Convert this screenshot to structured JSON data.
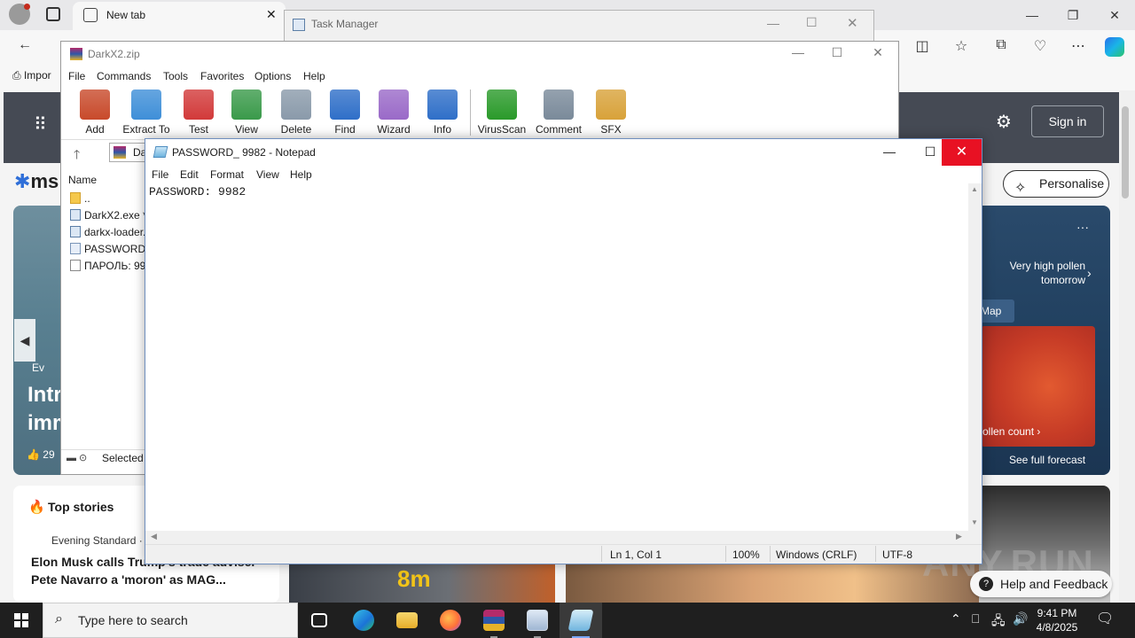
{
  "edge": {
    "tab_title": "New tab",
    "tab_close": "✕",
    "window_controls": [
      "—",
      "❐",
      "✕"
    ],
    "toolbar_icons": [
      "back-arrow-icon",
      "search-icon",
      "split-screen-icon",
      "favorites-star-icon",
      "collections-icon",
      "browser-essentials-icon",
      "more-menu-icon",
      "copilot-icon"
    ],
    "favorites_import": "Impor",
    "msn": {
      "logo": "ms",
      "sign_in": "Sign in",
      "personalise": "Personalise",
      "hero_source": "Ev",
      "hero_title_lines": [
        "Intr",
        "imm"
      ],
      "hero_likes": "29",
      "weather_alert": "Very high pollen tomorrow",
      "weather_map": "Map",
      "pollen_count": "ollen count ›",
      "see_full_forecast": "See full forecast",
      "top_stories": "Top stories",
      "story_source": "Evening Standard · 1",
      "story_headline": "Elon Musk calls Trump's trade adviser Pete Navarro a 'moron' as MAG...",
      "image_tag": "8m",
      "help_feedback": "Help and Feedback"
    },
    "watermark": "ANY.RUN"
  },
  "taskmanager": {
    "title": "Task Manager"
  },
  "winrar": {
    "title": "DarkX2.zip",
    "menu": [
      "File",
      "Commands",
      "Tools",
      "Favorites",
      "Options",
      "Help"
    ],
    "tools": [
      {
        "label": "Add",
        "color": "#c84a2b"
      },
      {
        "label": "Extract To",
        "color": "#3f8fd8"
      },
      {
        "label": "Test",
        "color": "#d23a3a"
      },
      {
        "label": "View",
        "color": "#3a9a4a"
      },
      {
        "label": "Delete",
        "color": "#8a9aaa"
      },
      {
        "label": "Find",
        "color": "#2f6fc8"
      },
      {
        "label": "Wizard",
        "color": "#9a6ac8"
      },
      {
        "label": "Info",
        "color": "#2f6fc8"
      },
      {
        "label": "VirusScan",
        "color": "#2a9a2a"
      },
      {
        "label": "Comment",
        "color": "#7a8a9a"
      },
      {
        "label": "SFX",
        "color": "#d8a23a"
      }
    ],
    "address": "Da",
    "column_name": "Name",
    "files": [
      "..",
      "DarkX2.exe *",
      "darkx-loader.",
      "PASSWORD: 9",
      "ПАРОЛЬ: 998"
    ],
    "status": "Selected"
  },
  "notepad": {
    "title": "PASSWORD_ 9982 - Notepad",
    "menu": [
      "File",
      "Edit",
      "Format",
      "View",
      "Help"
    ],
    "content": "PASSWORD: 9982",
    "status": {
      "position": "Ln 1, Col 1",
      "zoom": "100%",
      "line_ending": "Windows (CRLF)",
      "encoding": "UTF-8"
    }
  },
  "taskbar": {
    "search_placeholder": "Type here to search",
    "apps": [
      "task-view-icon",
      "edge-icon",
      "file-explorer-icon",
      "firefox-icon",
      "winrar-icon",
      "task-manager-icon",
      "notepad-icon"
    ],
    "time": "9:41 PM",
    "date": "4/8/2025"
  }
}
